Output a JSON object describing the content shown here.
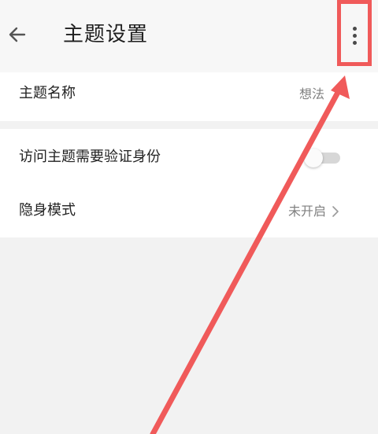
{
  "header": {
    "title": "主题设置",
    "back_icon": "arrow-left-icon",
    "more_icon": "more-vertical-icon"
  },
  "settings": {
    "theme_name": {
      "label": "主题名称",
      "value": "想法"
    },
    "verify_identity": {
      "label": "访问主题需要验证身份",
      "enabled": false
    },
    "incognito": {
      "label": "隐身模式",
      "value": "未开启",
      "chevron_icon": "chevron-right-icon"
    }
  },
  "annotation": {
    "color": "#f05a5a",
    "highlight": "more-button",
    "arrow_icon": "arrow-up-right-icon"
  },
  "colors": {
    "background": "#f2f2f2",
    "card": "#ffffff",
    "secondary_text": "#808080"
  }
}
